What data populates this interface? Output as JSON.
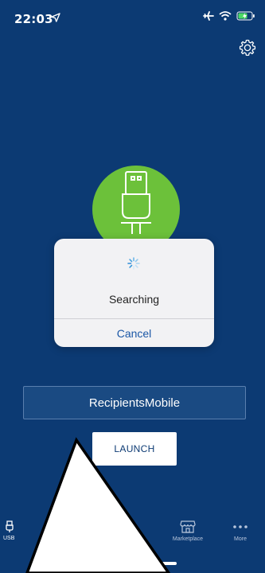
{
  "status_bar": {
    "time": "22:03"
  },
  "dialog": {
    "status_text": "Searching",
    "cancel_label": "Cancel"
  },
  "device_name": "RecipientsMobile",
  "launch_label": "LAUNCH",
  "tabs": [
    {
      "label": "USB",
      "icon": "usb-icon"
    },
    {
      "label": "Marketplace",
      "icon": "marketplace-icon"
    },
    {
      "label": "More",
      "icon": "more-icon"
    }
  ],
  "colors": {
    "background": "#0c3a73",
    "accent_green": "#6cc13a",
    "link_blue": "#1b57a6"
  }
}
